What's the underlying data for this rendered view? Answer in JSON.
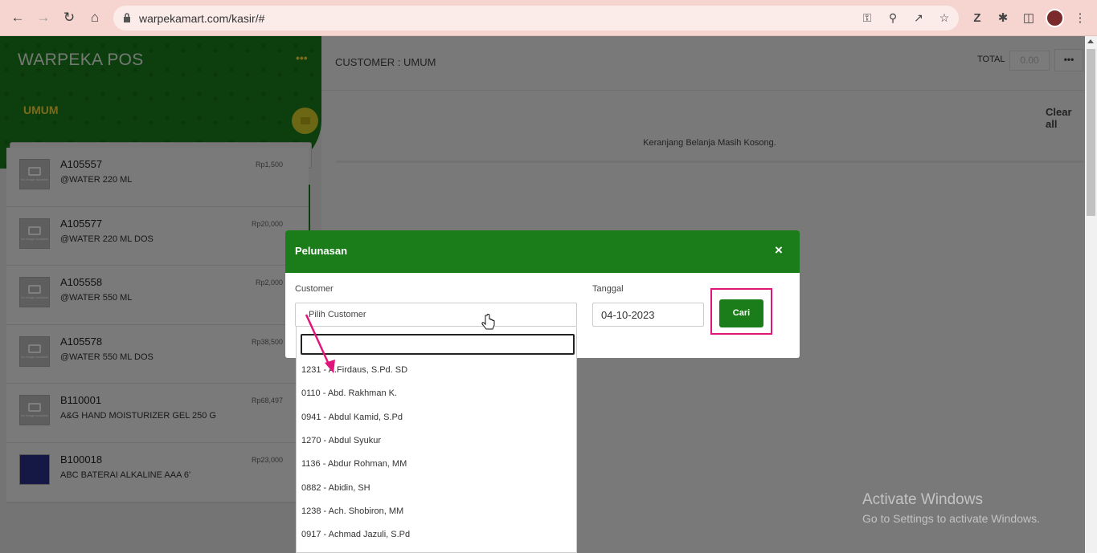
{
  "browser": {
    "url": "warpekamart.com/kasir/#"
  },
  "sidebar": {
    "brand": "WARPEKA POS",
    "menu_icon": "•••",
    "customer": "UMUM",
    "products": [
      {
        "code": "A105557",
        "name": "@WATER 220 ML",
        "price": "Rp1,500",
        "image": "No Image available"
      },
      {
        "code": "A105577",
        "name": "@WATER 220 ML DOS",
        "price": "Rp20,000",
        "image": "No Image available"
      },
      {
        "code": "A105558",
        "name": "@WATER 550 ML",
        "price": "Rp2,000",
        "image": "No Image available"
      },
      {
        "code": "A105578",
        "name": "@WATER 550 ML DOS",
        "price": "Rp38,500",
        "image": "No Image available"
      },
      {
        "code": "B110001",
        "name": "A&G HAND MOISTURIZER GEL 250 G",
        "price": "Rp68,497",
        "image": "No Image available"
      },
      {
        "code": "B100018",
        "name": "ABC BATERAI ALKALINE AAA 6'",
        "price": "Rp23,000",
        "image": "photo"
      }
    ]
  },
  "main": {
    "customer_title": "CUSTOMER : UMUM",
    "total_label": "TOTAL",
    "total_value": "0.00",
    "more_icon": "•••",
    "clear_all": "Clear all",
    "empty_cart": "Keranjang Belanja Masih Kosong."
  },
  "modal": {
    "title": "Pelunasan",
    "close": "×",
    "customer_label": "Customer",
    "customer_placeholder": "Pilih Customer",
    "date_label": "Tanggal",
    "date_value": "04-10-2023",
    "search_button": "Cari"
  },
  "dropdown": {
    "options": [
      "1231 - A.Firdaus, S.Pd. SD",
      "0110 - Abd. Rakhman K.",
      "0941 - Abdul Kamid, S.Pd",
      "1270 - Abdul Syukur",
      "1136 - Abdur Rohman, MM",
      "0882 - Abidin, SH",
      "1238 - Ach. Shobiron, MM",
      "0917 - Achmad Jazuli, S.Pd"
    ]
  },
  "watermark": {
    "line1": "Activate Windows",
    "line2": "Go to Settings to activate Windows."
  },
  "colors": {
    "brand_green": "#1a7d1a",
    "accent_yellow": "#f3d53a",
    "annotation_pink": "#e0157c"
  }
}
